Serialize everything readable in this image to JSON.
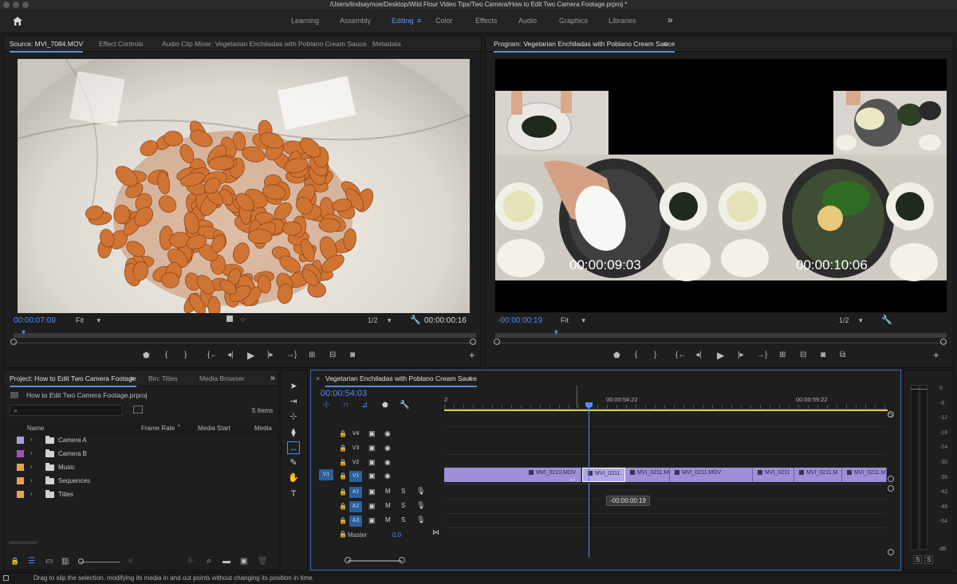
{
  "titlebar": {
    "path": "/Users/lindsaymoe/Desktop/Wild Flour Video Tips/Two Camera/How to Edit Two Camera Footage.prproj *"
  },
  "workspaces": {
    "tabs": [
      "Learning",
      "Assembly",
      "Editing",
      "Color",
      "Effects",
      "Audio",
      "Graphics",
      "Libraries"
    ],
    "active": "Editing",
    "more": "»"
  },
  "source": {
    "tabs": [
      "Source: MVI_7084.MOV",
      "Effect Controls",
      "Audio Clip Mixer: Vegetarian Enchiladas with Poblano Cream Sauce",
      "Metadata"
    ],
    "timecode": "00:00:07:09",
    "fit": "Fit",
    "resolution": "1/2",
    "duration": "00:00:00:16"
  },
  "program": {
    "title": "Program: Vegetarian Enchiladas with Poblano Cream Sauce",
    "timecode": "-00:00:00:19",
    "fit": "Fit",
    "resolution": "1/2",
    "overlay_tc_left": "00:00:09:03",
    "overlay_tc_right": "00:00:10:06"
  },
  "project": {
    "tabs": [
      "Project: How to Edit Two Camera Footage",
      "Bin: Titles",
      "Media Browser"
    ],
    "more": "»",
    "file": "How to Edit Two Camera Footage.prproj",
    "count": "5 Items",
    "columns": [
      "Name",
      "Frame Rate",
      "Media Start",
      "Media"
    ],
    "items": [
      {
        "name": "Camera A",
        "color": "#a99ee0"
      },
      {
        "name": "Camera B",
        "color": "#a64fb8"
      },
      {
        "name": "Music",
        "color": "#e3a548"
      },
      {
        "name": "Sequences",
        "color": "#e3a548"
      },
      {
        "name": "Titles",
        "color": "#e3a548"
      }
    ]
  },
  "timeline": {
    "title": "Vegetarian Enchiladas with Poblano Cream Sauce",
    "timecode": "00:00:54:03",
    "ruler": [
      "2",
      "00:00:54:22",
      "00:00:59:22"
    ],
    "video_tracks": [
      "V4",
      "V3",
      "V2",
      "V1"
    ],
    "audio_tracks": [
      "A1",
      "A2",
      "A3"
    ],
    "source_patch_v": "V1",
    "master_label": "Master",
    "master_value": "0.0",
    "clips": [
      "MVI_0210.MOV",
      "MVI_0211",
      "MVI_0211.MO",
      "MVI_0211.MOV",
      "MVI_0211",
      "MVI_0211.M",
      "MVI_0211.M"
    ],
    "tooltip": "-00:00:00:19",
    "btn_m": "M",
    "btn_s": "S"
  },
  "meter": {
    "labels": [
      "0",
      "-6",
      "-12",
      "-18",
      "-24",
      "-30",
      "-36",
      "-42",
      "-48",
      "-54",
      "dB"
    ],
    "solo": [
      "S",
      "S"
    ]
  },
  "statusbar": {
    "text": "Drag to slip the selection, modifying its media in and out points without changing its position in time."
  },
  "colors": {
    "accent_blue": "#4f8df5",
    "clip_purple": "#9f8fd8",
    "yellow_bar": "#d9cf4a"
  }
}
